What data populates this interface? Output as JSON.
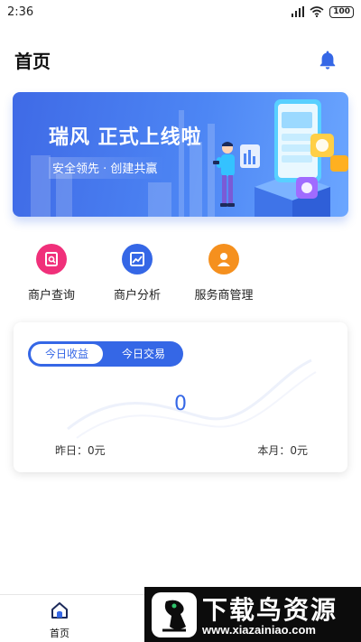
{
  "status_bar": {
    "time": "2:36",
    "battery": "100"
  },
  "header": {
    "title": "首页"
  },
  "banner": {
    "title": "瑞风  正式上线啦",
    "subtitle": "安全领先 · 创建共赢"
  },
  "quick_menu": [
    {
      "label": "商户查询",
      "icon": "merchant-search-icon",
      "color": "#f0307a"
    },
    {
      "label": "商户分析",
      "icon": "merchant-analysis-icon",
      "color": "#3567e6"
    },
    {
      "label": "服务商管理",
      "icon": "provider-management-icon",
      "color": "#f5901e"
    }
  ],
  "earnings_card": {
    "tabs": [
      "今日收益",
      "今日交易"
    ],
    "active_tab": "今日收益",
    "value": "0",
    "yesterday": "昨日：0元",
    "this_month": "本月：0元"
  },
  "bottom_nav": {
    "home_label": "首页"
  },
  "watermark": {
    "title": "下载鸟资源",
    "url": "www.xiazainiao.com"
  },
  "colors": {
    "primary": "#3567e6",
    "pink": "#f0307a",
    "orange": "#f5901e"
  }
}
